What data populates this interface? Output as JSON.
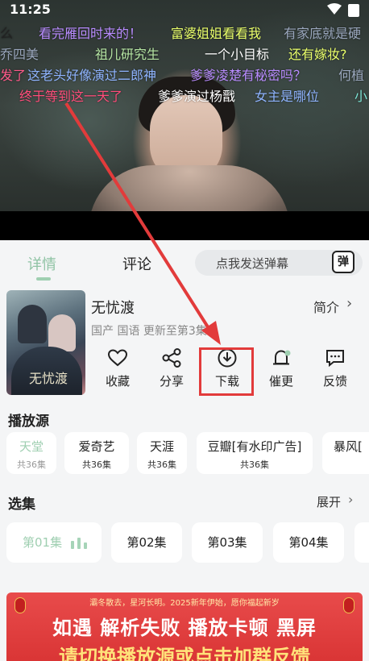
{
  "status_bar": {
    "time": "11:25"
  },
  "danmaku": [
    {
      "text": "么",
      "color": "#ffffff"
    },
    {
      "text": "看完雁回时来的！",
      "color": "#b98cff"
    },
    {
      "text": "富婆姐姐看看我",
      "color": "#eaff6a"
    },
    {
      "text": "有家底就是硬",
      "color": "#9aa7bd"
    },
    {
      "text": "乔四美",
      "color": "#9aa7bd"
    },
    {
      "text": "祖儿研究生",
      "color": "#b6e6a4"
    },
    {
      "text": "一个小目标",
      "color": "#ffffff"
    },
    {
      "text": "还有嫁妆?",
      "color": "#eaff6a"
    },
    {
      "text": "发了",
      "color": "#ff5a8a"
    },
    {
      "text": "这老头好像演过二郎神",
      "color": "#8fb4ff"
    },
    {
      "text": "爹爹凌楚有秘密吗？",
      "color": "#b98cff"
    },
    {
      "text": "何植",
      "color": "#9aa7bd"
    },
    {
      "text": "终于等到这一天了",
      "color": "#ff4d7a"
    },
    {
      "text": "爹爹演过杨戬",
      "color": "#ffffff"
    },
    {
      "text": "女主是哪位",
      "color": "#8fb4ff"
    },
    {
      "text": "小",
      "color": "#7ee6d6"
    }
  ],
  "tabs": {
    "details": "详情",
    "comments": "评论"
  },
  "danmaku_input": {
    "placeholder": "点我发送弹幕",
    "button": "弹"
  },
  "show": {
    "title": "无忧渡",
    "intro": "简介",
    "meta": "国产 国语 更新至第3集",
    "poster_title": "无忧渡"
  },
  "actions": {
    "favorite": "收藏",
    "share": "分享",
    "download": "下载",
    "urge": "催更",
    "feedback": "反馈"
  },
  "sources_title": "播放源",
  "sources": [
    {
      "name": "天堂",
      "count": "共36集"
    },
    {
      "name": "爱奇艺",
      "count": "共36集"
    },
    {
      "name": "天涯",
      "count": "共36集"
    },
    {
      "name": "豆瓣[有水印广告]",
      "count": "共36集"
    },
    {
      "name": "暴风["
    }
  ],
  "episodes_title": "选集",
  "expand": "展开",
  "episodes": [
    "第01集",
    "第02集",
    "第03集",
    "第04集"
  ],
  "banner": {
    "small": "灞冬散去，星河长明。2025新年伊始，愿你福起新岁",
    "line1": "如遇 解析失败 播放卡顿 黑屏",
    "line2": "请切换播放源或点击加群反馈"
  },
  "colors": {
    "accent": "#9fcfb1",
    "highlight": "#e23b3b"
  }
}
